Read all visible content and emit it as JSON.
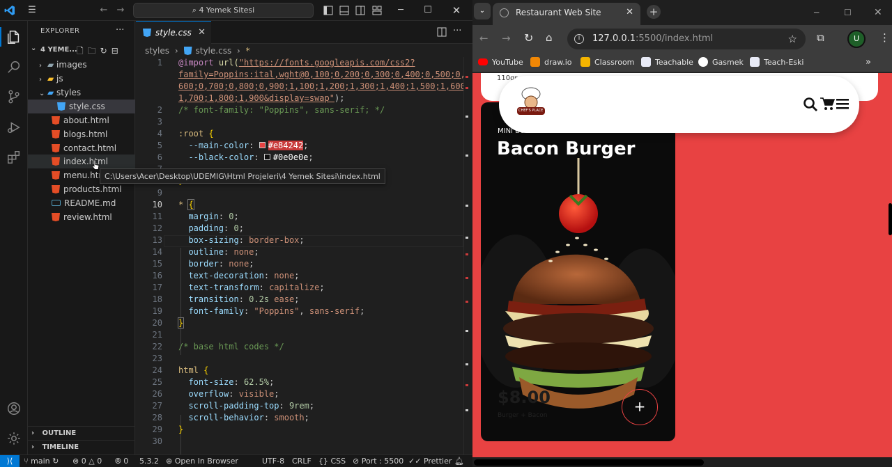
{
  "vscode": {
    "search_text": "4 Yemek Sitesi",
    "explorer_title": "EXPLORER",
    "folder_name": "4 YEME...",
    "tree": [
      {
        "label": "images",
        "type": "folder",
        "expanded": false
      },
      {
        "label": "js",
        "type": "folder",
        "expanded": false
      },
      {
        "label": "styles",
        "type": "folder",
        "expanded": true
      },
      {
        "label": "style.css",
        "type": "css"
      },
      {
        "label": "about.html",
        "type": "html"
      },
      {
        "label": "blogs.html",
        "type": "html"
      },
      {
        "label": "contact.html",
        "type": "html"
      },
      {
        "label": "index.html",
        "type": "html"
      },
      {
        "label": "menu.html",
        "type": "html"
      },
      {
        "label": "products.html",
        "type": "html"
      },
      {
        "label": "README.md",
        "type": "md"
      },
      {
        "label": "review.html",
        "type": "html"
      }
    ],
    "tooltip": "C:\\Users\\Acer\\Desktop\\UDEMIG\\Html Projeleri\\4 Yemek Sitesi\\index.html",
    "outline": "OUTLINE",
    "timeline": "TIMELINE",
    "tab_label": "style.css",
    "breadcrumb": [
      "styles",
      "style.css",
      "*"
    ],
    "line_numbers": [
      "1",
      "",
      "",
      "",
      "2",
      "3",
      "4",
      "5",
      "6",
      "7",
      "8",
      "9",
      "10",
      "11",
      "12",
      "13",
      "14",
      "15",
      "16",
      "17",
      "18",
      "19",
      "20",
      "21",
      "22",
      "23",
      "24",
      "25",
      "26",
      "27",
      "28",
      "29",
      "30"
    ],
    "code": {
      "l1a": "url(",
      "l1s": "\"https://fonts.googleapis.com/css2?",
      "l1b": "family=Poppins:ital,wght@0,100;0,200;0,300;0,400;0,500;0,",
      "l1c": "600;0,700;0,800;0,900;1,100;1,200;1,300;1,400;1,500;1,600;",
      "l1d": "1,700;1,800;1,900&display=swap\"",
      "l1e": ");",
      "l2": "/* font-family: \"Poppins\", sans-serif; */",
      "l4": ":root",
      "l5p": "--main-color",
      "l5v": "#e84242",
      "l6p": "--black-color",
      "l6v": "#0e0e0e",
      "l10": "*",
      "l11p": "margin",
      "l11v": "0",
      "l12p": "padding",
      "l12v": "0",
      "l13p": "box-sizing",
      "l13v": "border-box",
      "l14p": "outline",
      "l14v": "none",
      "l15p": "border",
      "l15v": "none",
      "l16p": "text-decoration",
      "l16v": "none",
      "l17p": "text-transform",
      "l17v": "capitalize",
      "l18p": "transition",
      "l18v": "0.2s",
      "l18w": "ease",
      "l19p": "font-family",
      "l19v": "\"Poppins\"",
      "l19w": "sans-serif",
      "l22": "/* base html codes */",
      "l24": "html",
      "l25p": "font-size",
      "l25v": "62.5%",
      "l26p": "overflow",
      "l26v": "visible",
      "l27p": "scroll-padding-top",
      "l27v": "9rem",
      "l28p": "scroll-behavior",
      "l28v": "smooth",
      "import": "@import"
    },
    "status": {
      "branch": "main",
      "errors": "0",
      "warnings": "0",
      "ports_ico": "0",
      "version": "5.3.2",
      "open_in_browser": "Open In Browser",
      "encoding": "UTF-8",
      "eol": "CRLF",
      "language": "CSS",
      "port": "Port : 5500",
      "prettier": "Prettier"
    }
  },
  "chrome": {
    "tab_title": "Restaurant Web Site",
    "url_host": "127.0.0.1",
    "url_path": ":5500/index.html",
    "profile_initial": "U",
    "bookmarks": [
      "YouTube",
      "draw.io",
      "Classroom",
      "Teachable",
      "Gasmek",
      "Teach-Eski"
    ],
    "page": {
      "top_peek": "110gr",
      "logo_text": "CHEF'S PLACE",
      "card_kicker": "MINI BURGER",
      "card_title": "Bacon Burger",
      "card_price": "$8.00",
      "card_sub": "Burger + Bacon",
      "plus": "+"
    }
  },
  "colors": {
    "main": "#e84242",
    "black": "#0e0e0e",
    "vscode_accent": "#0078d4"
  }
}
